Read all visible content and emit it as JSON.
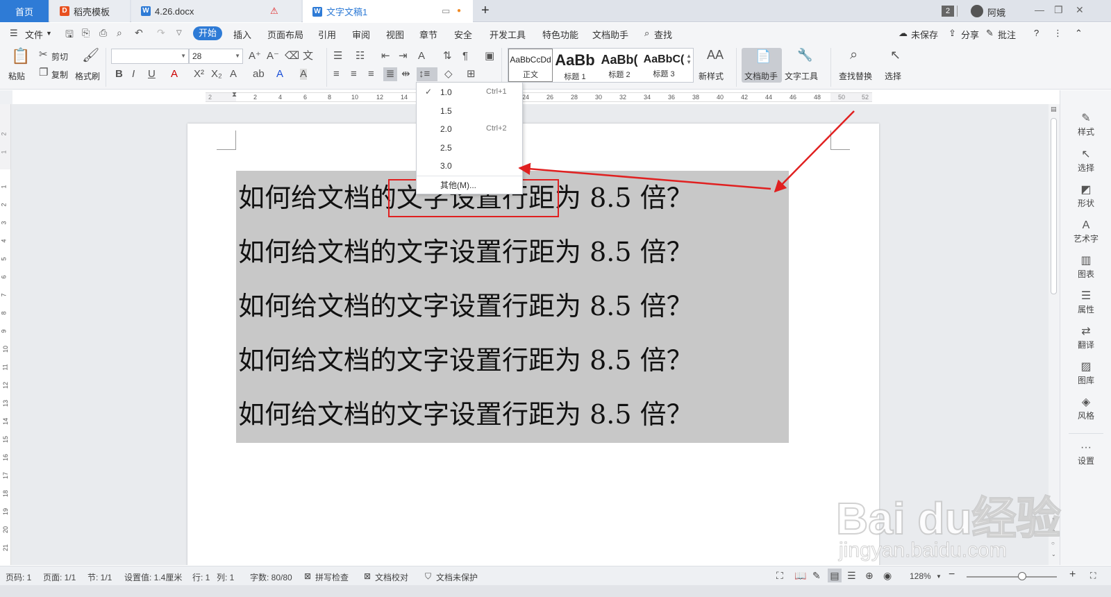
{
  "tabs": {
    "home": "首页",
    "templates": "稻壳模板",
    "doc426": "4.26.docx",
    "doc1": "文字文稿1"
  },
  "window": {
    "badge": "2",
    "user": "阿娥"
  },
  "menu": {
    "file": "文件",
    "items": [
      "开始",
      "插入",
      "页面布局",
      "引用",
      "审阅",
      "视图",
      "章节",
      "安全",
      "开发工具",
      "特色功能",
      "文档助手"
    ],
    "search": "查找",
    "unsaved": "未保存",
    "share": "分享",
    "comment": "批注"
  },
  "ribbon": {
    "paste": "粘贴",
    "cut": "剪切",
    "copy": "复制",
    "format_painter": "格式刷",
    "font_name": "",
    "font_size": "28",
    "styles": [
      {
        "preview": "AaBbCcDd",
        "label": "正文"
      },
      {
        "preview": "AaBb",
        "label": "标题 1"
      },
      {
        "preview": "AaBb(",
        "label": "标题 2"
      },
      {
        "preview": "AaBbC(",
        "label": "标题 3"
      }
    ],
    "new_style": "新样式",
    "doc_assistant": "文档助手",
    "text_tools": "文字工具",
    "find_replace": "查找替换",
    "select": "选择"
  },
  "ruler": {
    "h_ticks": [
      "2",
      "2",
      "4",
      "6",
      "8",
      "10",
      "12",
      "14",
      "16",
      "18",
      "20",
      "22",
      "24",
      "26",
      "28",
      "30",
      "32",
      "34",
      "36",
      "38",
      "40",
      "42",
      "44",
      "46",
      "48",
      "50",
      "52"
    ],
    "v_ticks": [
      "2",
      "1",
      "1",
      "2",
      "3",
      "4",
      "5",
      "6",
      "7",
      "8",
      "9",
      "10",
      "11",
      "12",
      "13",
      "14",
      "15",
      "16",
      "17",
      "18",
      "19",
      "20",
      "21"
    ]
  },
  "document": {
    "lines": [
      "如何给文档的文字设置行距为 8.5 倍？",
      "如何给文档的文字设置行距为 8.5 倍？",
      "如何给文档的文字设置行距为 8.5 倍？",
      "如何给文档的文字设置行距为 8.5 倍？",
      "如何给文档的文字设置行距为 8.5 倍？"
    ]
  },
  "line_spacing_menu": {
    "selected": "1.0",
    "items": [
      {
        "value": "1.0",
        "shortcut": "Ctrl+1"
      },
      {
        "value": "1.5",
        "shortcut": ""
      },
      {
        "value": "2.0",
        "shortcut": "Ctrl+2"
      },
      {
        "value": "2.5",
        "shortcut": ""
      },
      {
        "value": "3.0",
        "shortcut": ""
      },
      {
        "value": "其他(M)...",
        "shortcut": ""
      }
    ]
  },
  "sidebar": {
    "items": [
      "样式",
      "选择",
      "形状",
      "艺术字",
      "图表",
      "属性",
      "翻译",
      "图库",
      "风格",
      "设置"
    ]
  },
  "status": {
    "page_no": "页码: 1",
    "pages": "页面: 1/1",
    "section": "节: 1/1",
    "setting": "设置值: 1.4厘米",
    "row": "行: 1",
    "col": "列: 1",
    "words": "字数: 80/80",
    "spell": "拼写检查",
    "proof": "文档校对",
    "protect": "文档未保护",
    "zoom": "128%"
  },
  "watermark": {
    "brand": "Bai du经验",
    "url": "jingyan.baidu.com"
  },
  "colors": {
    "accent": "#2e7bd6",
    "highlight": "#c8c8c8",
    "annotation": "#e02020"
  }
}
